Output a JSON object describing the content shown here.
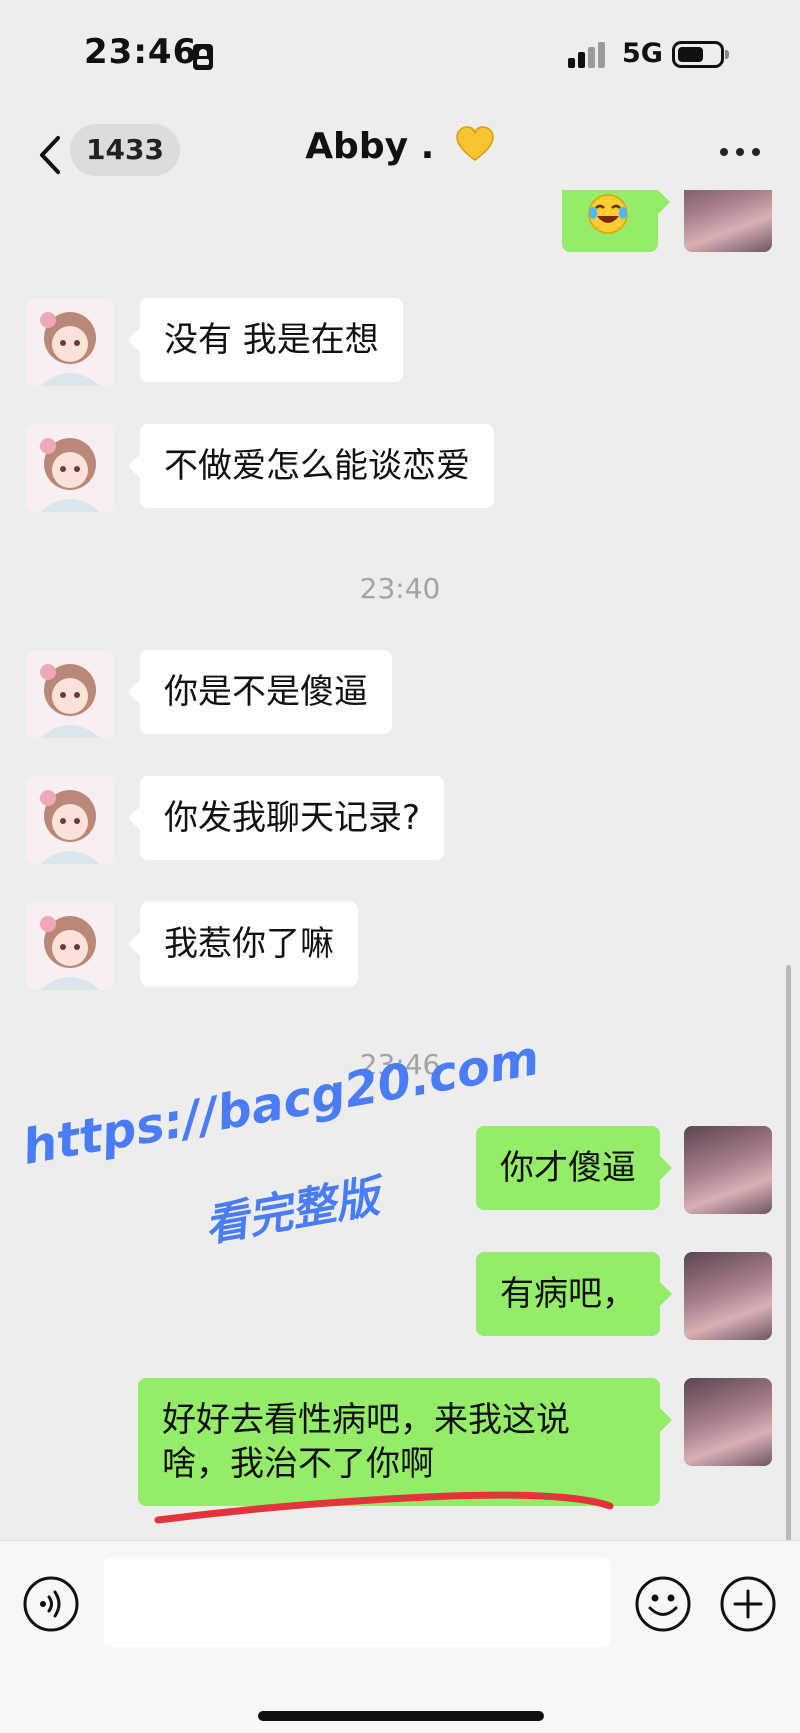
{
  "status_bar": {
    "time": "23:46",
    "network": "5G"
  },
  "nav": {
    "unread_count": "1433",
    "title": "Abby .",
    "title_emoji_icon": "yellow-heart-icon"
  },
  "messages": [
    {
      "from": "self",
      "type": "emoji",
      "icon": "laughing-crying-emoji-icon"
    },
    {
      "from": "other",
      "text": "没有 我是在想"
    },
    {
      "from": "other",
      "text": "不做爱怎么能谈恋爱"
    },
    {
      "type": "time",
      "text": "23:40"
    },
    {
      "from": "other",
      "text": "你是不是傻逼"
    },
    {
      "from": "other",
      "text": "你发我聊天记录?"
    },
    {
      "from": "other",
      "text": "我惹你了嘛"
    },
    {
      "type": "time",
      "text": "23:46"
    },
    {
      "from": "self",
      "text": "你才傻逼"
    },
    {
      "from": "self",
      "text": "有病吧，"
    },
    {
      "from": "self",
      "text": "好好去看性病吧，来我这说啥，我治不了你啊"
    }
  ],
  "watermark": {
    "url": "https://bacg20.com",
    "cta": "看完整版"
  },
  "input": {
    "value": "",
    "placeholder": ""
  },
  "colors": {
    "background": "#ededed",
    "outgoing_bubble": "#95ec69",
    "incoming_bubble": "#ffffff",
    "watermark": "#4a7cf7",
    "underline": "#e2343a"
  }
}
